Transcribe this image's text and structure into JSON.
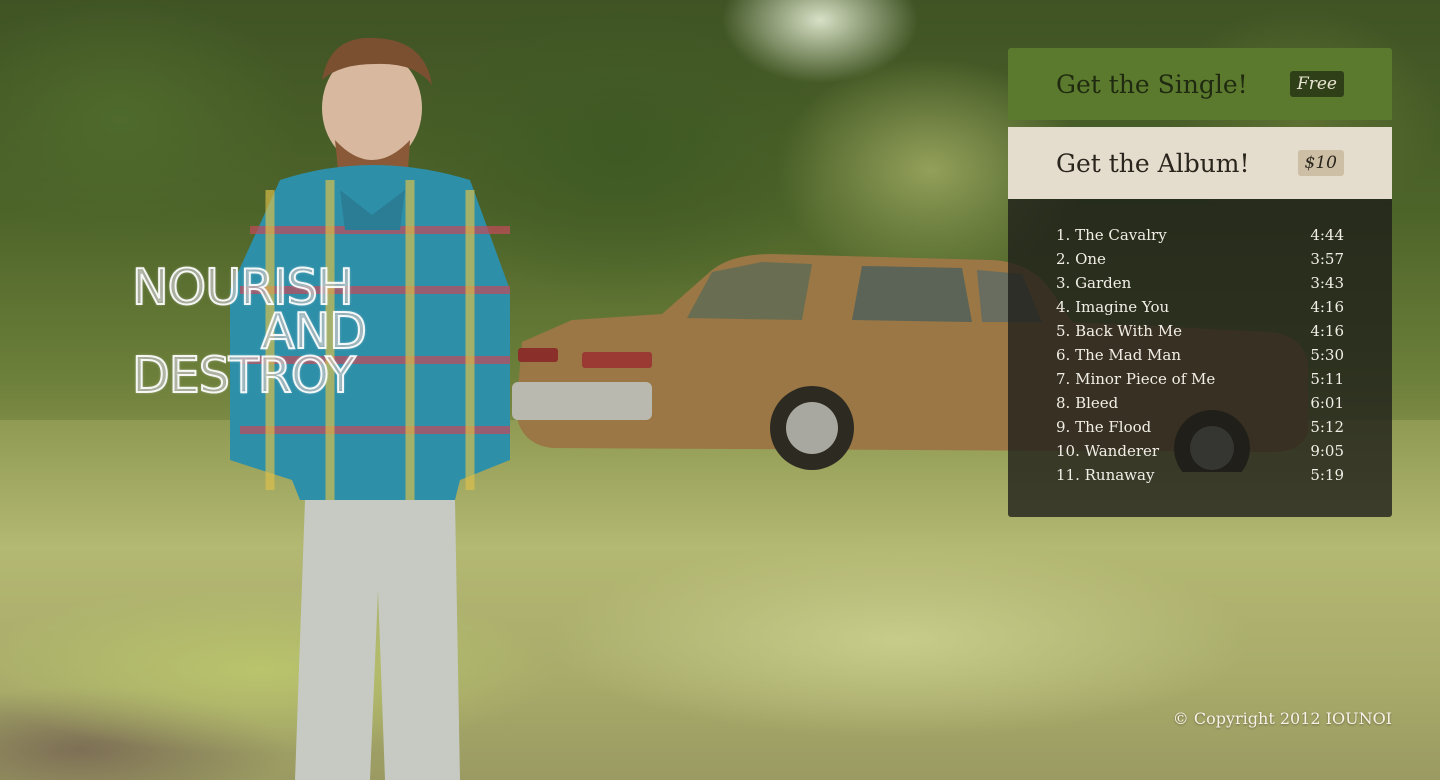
{
  "band": {
    "title_lines": [
      "NOURISH",
      "AND",
      "DESTROY"
    ]
  },
  "store": {
    "single": {
      "label": "Get the Single!",
      "price": "Free"
    },
    "album": {
      "label": "Get the Album!",
      "price": "$10"
    }
  },
  "tracks": [
    {
      "title": "1. The Cavalry",
      "duration": "4:44"
    },
    {
      "title": "2. One",
      "duration": "3:57"
    },
    {
      "title": "3. Garden",
      "duration": "3:43"
    },
    {
      "title": "4. Imagine You",
      "duration": "4:16"
    },
    {
      "title": "5. Back With Me",
      "duration": "4:16"
    },
    {
      "title": "6. The Mad Man",
      "duration": "5:30"
    },
    {
      "title": "7. Minor Piece of Me",
      "duration": "5:11"
    },
    {
      "title": "8. Bleed",
      "duration": "6:01"
    },
    {
      "title": "9. The Flood",
      "duration": "5:12"
    },
    {
      "title": "10. Wanderer",
      "duration": "9:05"
    },
    {
      "title": "11. Runaway",
      "duration": "5:19"
    }
  ],
  "footer": {
    "copyright": "© Copyright 2012 IOUNOI"
  },
  "colors": {
    "single_bg": "#5b7a2d",
    "album_bg": "#e4dccd",
    "tracklist_bg": "rgba(28,28,24,0.78)"
  }
}
